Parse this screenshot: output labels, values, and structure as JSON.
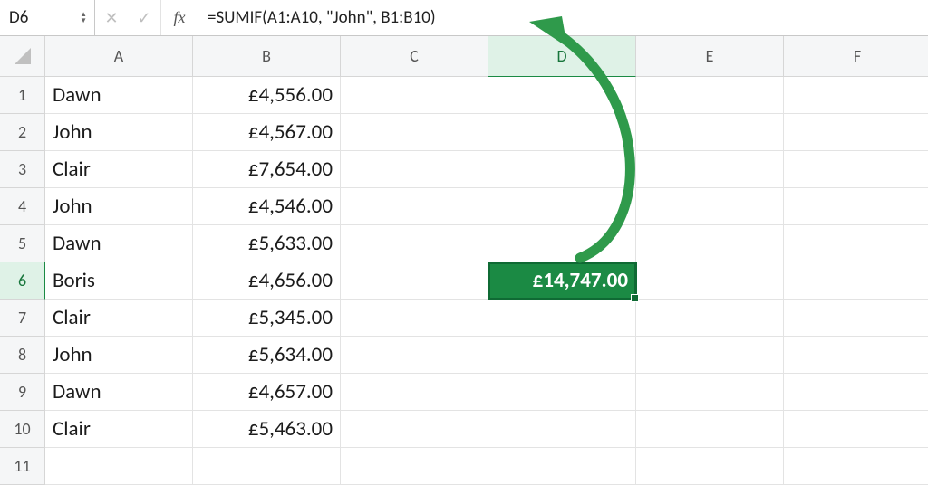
{
  "formula_bar": {
    "name_box": "D6",
    "cancel_glyph": "✕",
    "confirm_glyph": "✓",
    "fx_label": "fx",
    "formula": "=SUMIF(A1:A10, \"John\", B1:B10)"
  },
  "columns": [
    "A",
    "B",
    "C",
    "D",
    "E",
    "F"
  ],
  "active_column_index": 3,
  "rows": [
    {
      "n": "1",
      "a": "Dawn",
      "b": "£4,556.00",
      "d": ""
    },
    {
      "n": "2",
      "a": "John",
      "b": "£4,567.00",
      "d": ""
    },
    {
      "n": "3",
      "a": "Clair",
      "b": "£7,654.00",
      "d": ""
    },
    {
      "n": "4",
      "a": "John",
      "b": "£4,546.00",
      "d": ""
    },
    {
      "n": "5",
      "a": "Dawn",
      "b": "£5,633.00",
      "d": ""
    },
    {
      "n": "6",
      "a": "Boris",
      "b": "£4,656.00",
      "d": "£14,747.00"
    },
    {
      "n": "7",
      "a": "Clair",
      "b": "£5,345.00",
      "d": ""
    },
    {
      "n": "8",
      "a": "John",
      "b": "£5,634.00",
      "d": ""
    },
    {
      "n": "9",
      "a": "Dawn",
      "b": "£4,657.00",
      "d": ""
    },
    {
      "n": "10",
      "a": "Clair",
      "b": "£5,463.00",
      "d": ""
    },
    {
      "n": "11",
      "a": "",
      "b": "",
      "d": ""
    }
  ],
  "active_row_index": 5,
  "annotation": {
    "color": "#2f9a4b"
  }
}
